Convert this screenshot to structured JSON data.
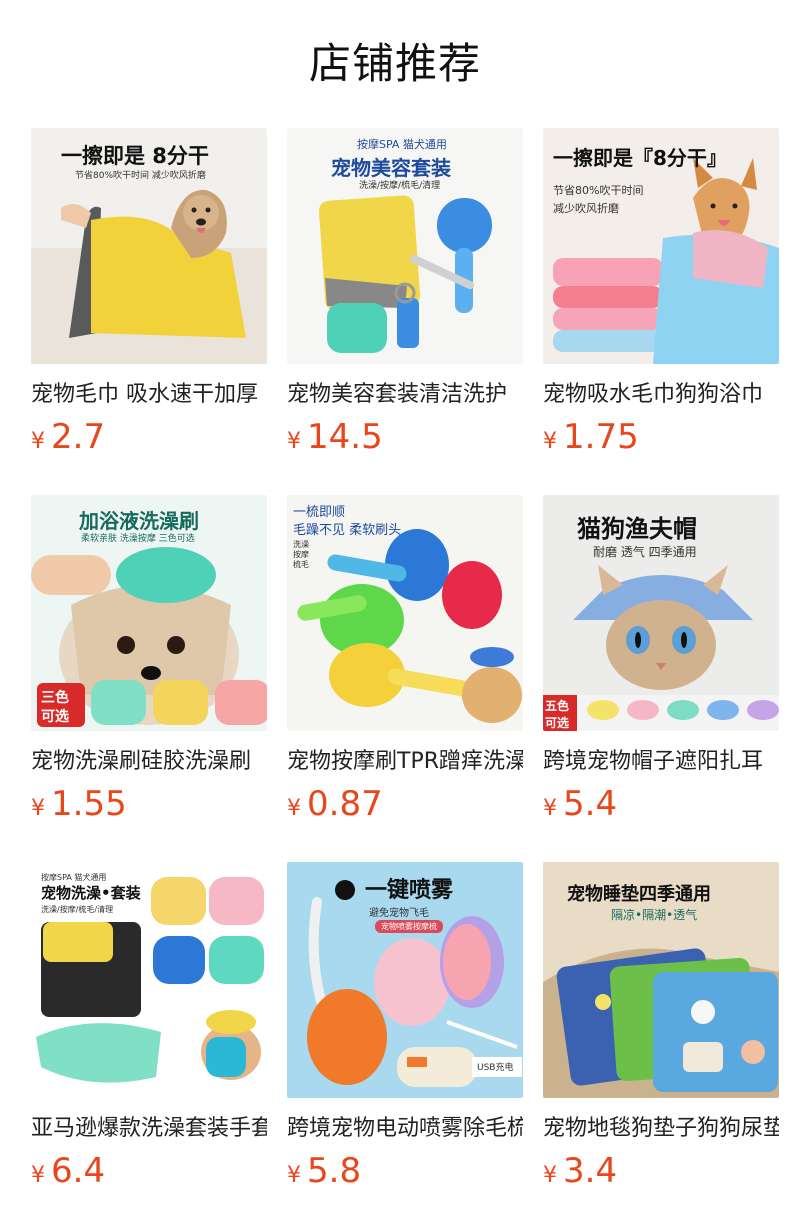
{
  "page": {
    "title": "店铺推荐"
  },
  "products": [
    {
      "title": "宠物毛巾 吸水速干加厚",
      "currency": "¥",
      "price": "2.7",
      "image": {
        "headline": "一擦即是 8分干",
        "sub": "节省80%吹干时间 减少吹风折磨",
        "icon": "dog-towel-image"
      }
    },
    {
      "title": "宠物美容套装清洁洗护",
      "currency": "¥",
      "price": "14.5",
      "image": {
        "top": "按摩SPA 猫犬通用",
        "headline": "宠物美容套装",
        "sub": "洗澡/按摩/梳毛/清理",
        "icon": "grooming-kit-image"
      }
    },
    {
      "title": "宠物吸水毛巾狗狗浴巾",
      "currency": "¥",
      "price": "1.75",
      "image": {
        "headline": "一擦即是『8分干』",
        "sub1": "节省80%吹干时间",
        "sub2": "减少吹风折磨",
        "icon": "corgi-towels-image"
      }
    },
    {
      "title": "宠物洗澡刷硅胶洗澡刷",
      "currency": "¥",
      "price": "1.55",
      "image": {
        "headline": "加浴液洗澡刷",
        "sub": "柔软亲肤 洗澡按摩 三色可选",
        "badge1": "三色",
        "badge2": "可选",
        "icon": "bath-brush-image"
      }
    },
    {
      "title": "宠物按摩刷TPR蹭痒洗澡",
      "currency": "¥",
      "price": "0.87",
      "image": {
        "line1": "一梳即顺",
        "line2": "毛躁不见 柔软刷头",
        "items": [
          "洗澡",
          "按摩",
          "梳毛"
        ],
        "icon": "tpr-brush-image"
      }
    },
    {
      "title": "跨境宠物帽子遮阳扎耳",
      "currency": "¥",
      "price": "5.4",
      "image": {
        "headline": "猫狗渔夫帽",
        "sub": "耐磨 透气 四季通用",
        "badge1": "五色",
        "badge2": "可选",
        "icon": "cat-hat-image"
      }
    },
    {
      "title": "亚马逊爆款洗澡套装手套",
      "currency": "¥",
      "price": "6.4",
      "image": {
        "top": "按摩SPA 猫犬通用",
        "headline": "宠物洗澡•套装",
        "sub": "洗澡/按摩/梳毛/清理",
        "icon": "bath-set-image"
      }
    },
    {
      "title": "跨境宠物电动喷雾除毛梳",
      "currency": "¥",
      "price": "5.8",
      "image": {
        "headline": "一键喷雾",
        "sub": "避免宠物飞毛",
        "tag": "宠物喷雾按摩梳",
        "usb": "USB充电",
        "icon": "spray-comb-image"
      }
    },
    {
      "title": "宠物地毯狗垫子狗狗尿垫",
      "currency": "¥",
      "price": "3.4",
      "image": {
        "headline": "宠物睡垫四季通用",
        "sub": "隔凉•隔潮•透气",
        "icon": "pet-mat-image"
      }
    }
  ],
  "colors": {
    "price": "#e8461b",
    "title": "#222222"
  }
}
